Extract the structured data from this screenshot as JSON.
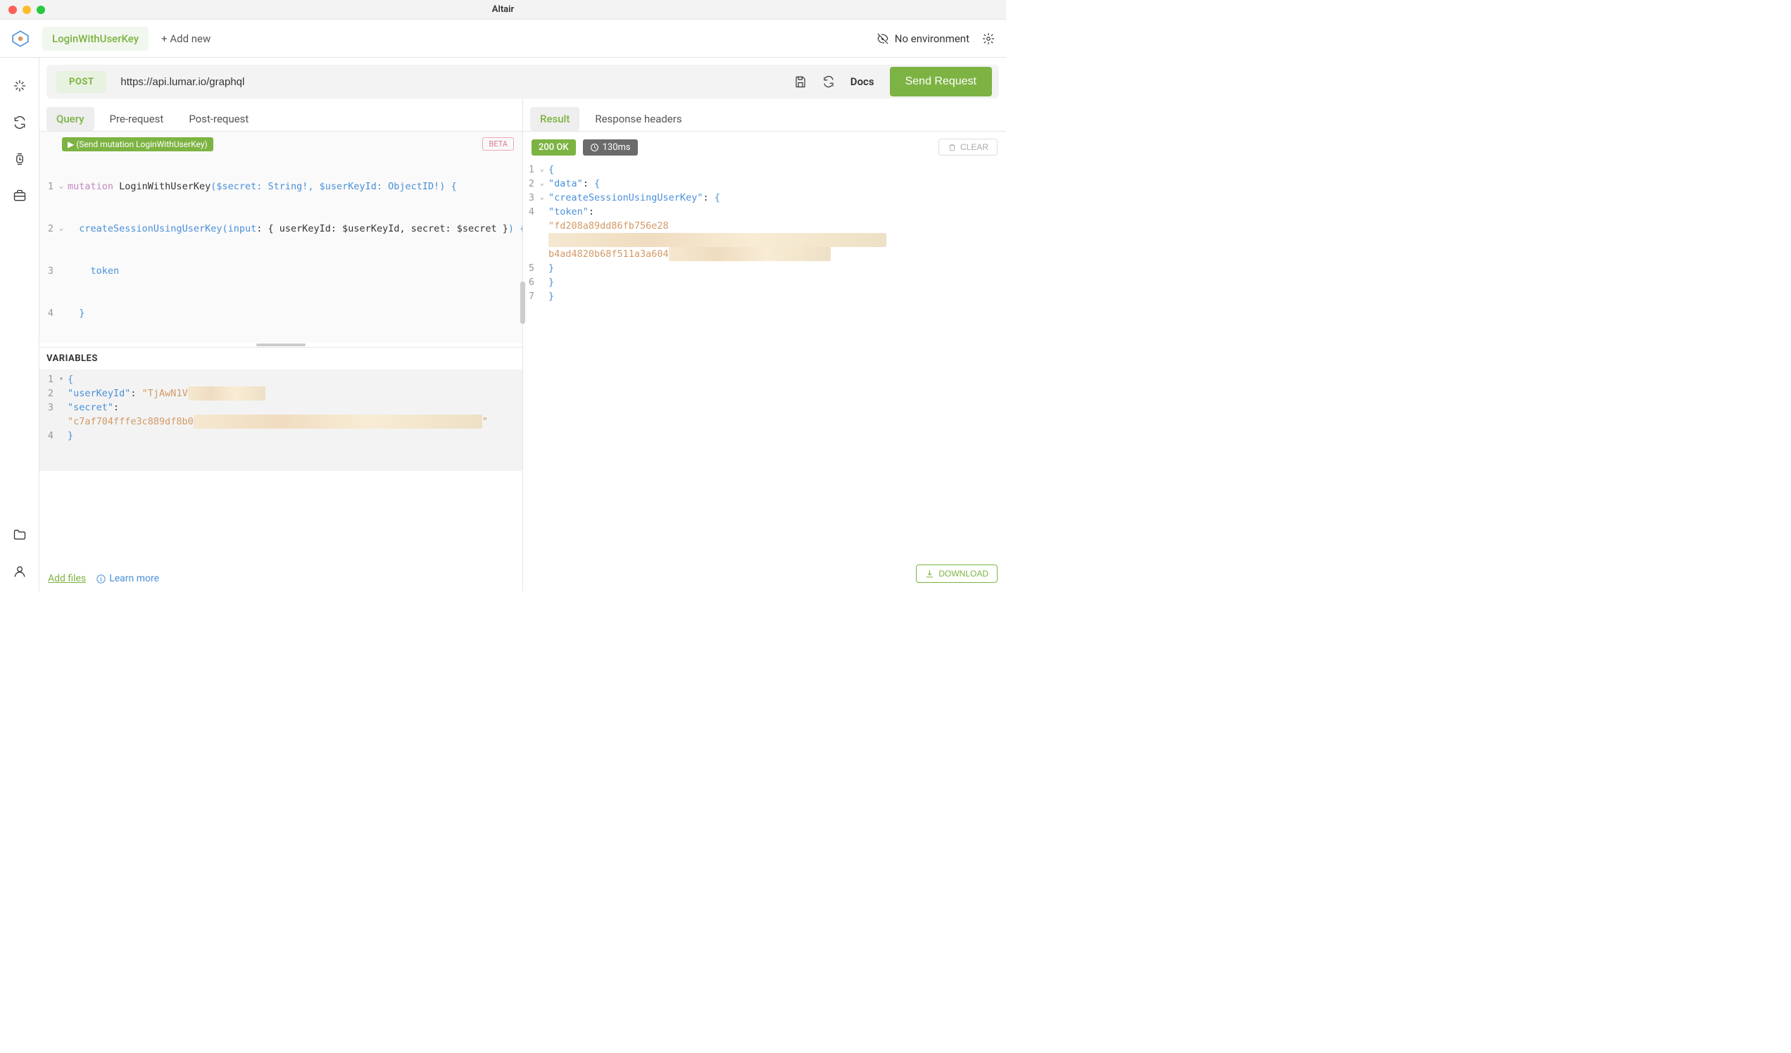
{
  "window": {
    "title": "Altair"
  },
  "topbar": {
    "active_tab": "LoginWithUserKey",
    "add_new": "+ Add new",
    "no_environment": "No environment"
  },
  "request": {
    "method": "POST",
    "url": "https://api.lumar.io/graphql",
    "docs_label": "Docs",
    "send_label": "Send Request"
  },
  "left_tabs": {
    "query": "Query",
    "pre": "Pre-request",
    "post": "Post-request"
  },
  "editor": {
    "run_hint": "▶ (Send mutation LoginWithUserKey)",
    "beta": "BETA",
    "lines": {
      "l1_kw": "mutation",
      "l1_name": " LoginWithUserKey",
      "l1_args": "($secret: String!, $userKeyId: ObjectID!)",
      "l1_brace": " {",
      "l2_fn": "createSessionUsingUserKey",
      "l2_open": "(input",
      "l2_colon": ": ",
      "l2_obj": "{ userKeyId: $userKeyId, secret: $secret }",
      "l2_close": ")",
      "l2_brace": " {",
      "l3": "token",
      "l4": "}",
      "l5": "}"
    }
  },
  "variables": {
    "header": "VARIABLES",
    "userKeyId_key": "\"userKeyId\"",
    "userKeyId_val": "\"TjAwN1V",
    "secret_key": "\"secret\"",
    "secret_val": "\"c7af704fffe3c889df8b0",
    "secret_trail": "\""
  },
  "right_tabs": {
    "result": "Result",
    "headers": "Response headers"
  },
  "response": {
    "status": "200 OK",
    "time": "130ms",
    "clear": "CLEAR",
    "download": "DOWNLOAD",
    "lines": {
      "data_key": "\"data\"",
      "create_key": "\"createSessionUsingUserKey\"",
      "token_key": "\"token\"",
      "token_val_a": "\"fd208a89dd86fb756e28",
      "token_val_b": "b4ad4820b68f511a3a604"
    }
  },
  "footer": {
    "add_files": "Add files",
    "learn_more": "Learn more"
  }
}
